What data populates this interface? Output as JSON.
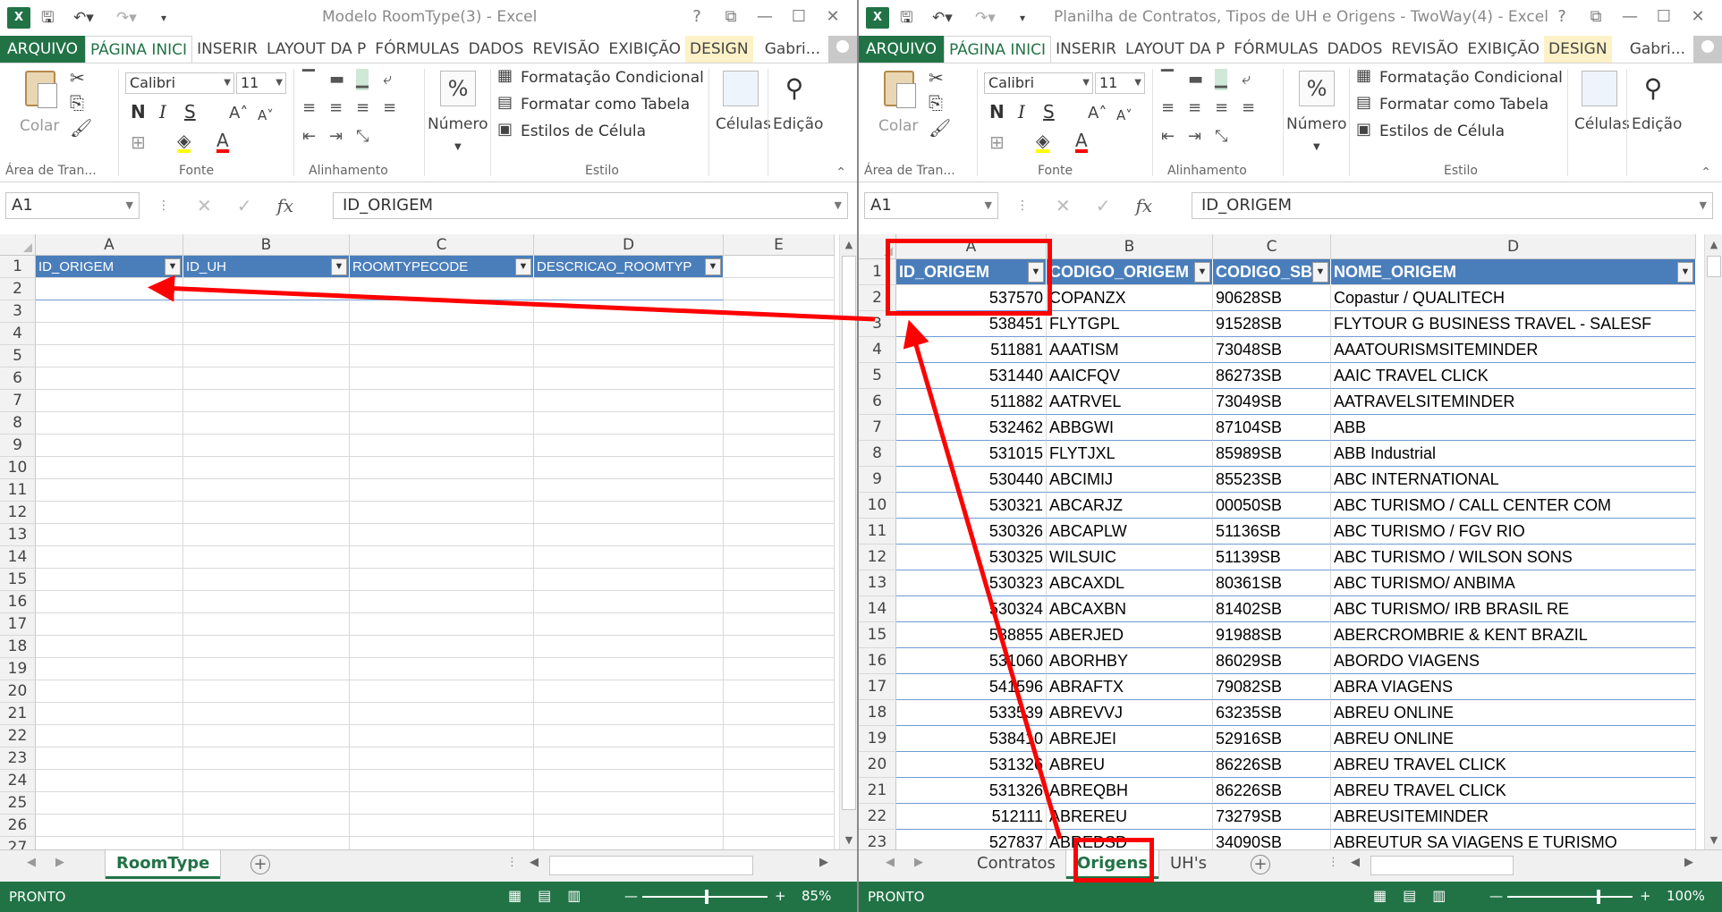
{
  "left": {
    "title": "Modelo RoomType(3) - Excel",
    "tabs": [
      "ARQUIVO",
      "PÁGINA INICI",
      "INSERIR",
      "LAYOUT DA P",
      "FÓRMULAS",
      "DADOS",
      "REVISÃO",
      "EXIBIÇÃO",
      "DESIGN"
    ],
    "user": "Gabri...",
    "name_box": "A1",
    "formula": "ID_ORIGEM",
    "columns": [
      "A",
      "B",
      "C",
      "D",
      "E"
    ],
    "table_headers": [
      "ID_ORIGEM",
      "ID_UH",
      "ROOMTYPECODE",
      "DESCRICAO_ROOMTYP"
    ],
    "row_numbers": [
      "1",
      "2",
      "3",
      "4",
      "5",
      "6",
      "7",
      "8",
      "9",
      "10",
      "11",
      "12",
      "13",
      "14",
      "15",
      "16",
      "17",
      "18",
      "19",
      "20",
      "21",
      "22",
      "23",
      "24",
      "25",
      "26",
      "27"
    ],
    "sheets": [
      "RoomType"
    ],
    "status": "PRONTO",
    "zoom": "85%"
  },
  "right": {
    "title": "Planilha de Contratos, Tipos de UH e Origens - TwoWay(4) - Excel",
    "tabs": [
      "ARQUIVO",
      "PÁGINA INICI",
      "INSERIR",
      "LAYOUT DA P",
      "FÓRMULAS",
      "DADOS",
      "REVISÃO",
      "EXIBIÇÃO",
      "DESIGN"
    ],
    "user": "Gabri...",
    "name_box": "A1",
    "formula": "ID_ORIGEM",
    "columns": [
      "A",
      "B",
      "C",
      "D"
    ],
    "table_headers": [
      "ID_ORIGEM",
      "CODIGO_ORIGEM",
      "CODIGO_SB",
      "NOME_ORIGEM"
    ],
    "rows": [
      [
        "537570",
        "COPANZX",
        "90628SB",
        " Copastur / QUALITECH"
      ],
      [
        "538451",
        "FLYTGPL",
        "91528SB",
        " FLYTOUR G BUSINESS TRAVEL - SALESF"
      ],
      [
        "511881",
        "AAATISM",
        "73048SB",
        "AAATOURISMSITEMINDER"
      ],
      [
        "531440",
        "AAICFQV",
        "86273SB",
        "AAIC TRAVEL CLICK"
      ],
      [
        "511882",
        "AATRVEL",
        "73049SB",
        "AATRAVELSITEMINDER"
      ],
      [
        "532462",
        "ABBGWI",
        "87104SB",
        "ABB"
      ],
      [
        "531015",
        "FLYTJXL",
        "85989SB",
        "ABB Industrial"
      ],
      [
        "530440",
        "ABCIMIJ",
        "85523SB",
        "ABC INTERNATIONAL"
      ],
      [
        "530321",
        "ABCARJZ",
        "00050SB",
        "ABC TURISMO / CALL CENTER COM"
      ],
      [
        "530326",
        "ABCAPLW",
        "51136SB",
        "ABC TURISMO / FGV RIO"
      ],
      [
        "530325",
        "WILSUIC",
        "51139SB",
        "ABC TURISMO / WILSON SONS"
      ],
      [
        "530323",
        "ABCAXDL",
        "80361SB",
        "ABC TURISMO/ ANBIMA"
      ],
      [
        "530324",
        "ABCAXBN",
        "81402SB",
        "ABC TURISMO/ IRB BRASIL RE"
      ],
      [
        "538855",
        "ABERJED",
        "91988SB",
        "ABERCROMBRIE & KENT BRAZIL"
      ],
      [
        "531060",
        "ABORHBY",
        "86029SB",
        "ABORDO VIAGENS"
      ],
      [
        "541596",
        "ABRAFTX",
        "79082SB",
        "ABRA VIAGENS"
      ],
      [
        "533539",
        "ABREVVJ",
        "63235SB",
        "ABREU ONLINE"
      ],
      [
        "538410",
        "ABREJEI",
        "52916SB",
        "ABREU ONLINE"
      ],
      [
        "531326",
        "ABREU",
        "86226SB",
        "ABREU TRAVEL CLICK"
      ],
      [
        "531326",
        "ABREQBH",
        "86226SB",
        "ABREU TRAVEL CLICK"
      ],
      [
        "512111",
        "ABREREU",
        "73279SB",
        "ABREUSITEMINDER"
      ],
      [
        "527837",
        "ABREDSD",
        "34090SB",
        "ABREUTUR SA VIAGENS E TURISMO"
      ]
    ],
    "row_numbers": [
      "1",
      "2",
      "3",
      "4",
      "5",
      "6",
      "7",
      "8",
      "9",
      "10",
      "11",
      "12",
      "13",
      "14",
      "15",
      "16",
      "17",
      "18",
      "19",
      "20",
      "21",
      "22",
      "23"
    ],
    "sheets": [
      "Contratos",
      "Origens",
      "UH's"
    ],
    "status": "PRONTO",
    "zoom": "100%"
  },
  "ribbon": {
    "paste": "Colar",
    "clipboard": "Área de Tran...",
    "font_name": "Calibri",
    "font_size": "11",
    "font_group": "Fonte",
    "align_group": "Alinhamento",
    "number": "Número",
    "cond_format": "Formatação Condicional",
    "format_table": "Formatar como Tabela",
    "cell_styles": "Estilos de Célula",
    "style_group": "Estilo",
    "cells": "Células",
    "edit": "Edição",
    "bold": "N",
    "italic": "I",
    "underline": "S"
  },
  "colors": {
    "excel_green": "#217346",
    "table_header_blue": "#4a7ebb",
    "annotation_red": "#ff0000",
    "design_tab": "#fdf1c7"
  }
}
